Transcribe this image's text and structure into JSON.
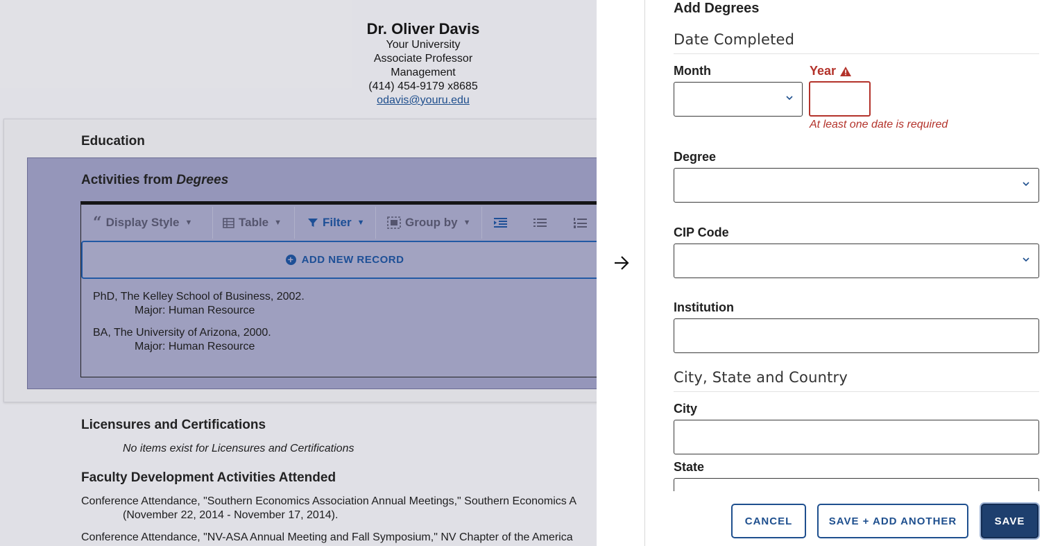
{
  "profile": {
    "name": "Dr. Oliver Davis",
    "university": "Your University",
    "rank": "Associate Professor",
    "department": "Management",
    "phone": "(414) 454-9179 x8685",
    "email": "odavis@youru.edu"
  },
  "education": {
    "heading": "Education",
    "activities_prefix": "Activities from ",
    "activities_emph": "Degrees",
    "toolbar": {
      "display_style": "Display Style",
      "table": "Table",
      "filter": "Filter",
      "group_by": "Group by"
    },
    "add_new_record": "ADD NEW RECORD",
    "records": [
      {
        "line": "PhD, The Kelley School of Business, 2002.",
        "major": "Major: Human Resource"
      },
      {
        "line": "BA, The University of Arizona, 2000.",
        "major": "Major: Human Resource"
      }
    ]
  },
  "licensures": {
    "heading": "Licensures and Certifications",
    "empty": "No items exist for Licensures and Certifications"
  },
  "faculty_dev": {
    "heading": "Faculty Development Activities Attended",
    "items": [
      {
        "line1": "Conference Attendance, \"Southern Economics Association Annual Meetings,\" Southern Economics A",
        "line2": "(November 22, 2014 - November 17, 2014)."
      },
      {
        "line1": "Conference Attendance, \"NV-ASA Annual Meeting and Fall Symposium,\" NV Chapter of the America"
      }
    ]
  },
  "form": {
    "title": "Add Degrees",
    "date_section": "Date Completed",
    "month_label": "Month",
    "month_value": "",
    "year_label": "Year",
    "year_value": "",
    "year_error": "At least one date is required",
    "degree_label": "Degree",
    "degree_value": "",
    "cip_label": "CIP Code",
    "cip_value": "",
    "institution_label": "Institution",
    "institution_value": "",
    "location_section": "City, State and Country",
    "city_label": "City",
    "city_value": "",
    "state_label": "State",
    "state_value": ""
  },
  "buttons": {
    "cancel": "CANCEL",
    "save_add_another": "SAVE + ADD ANOTHER",
    "save": "SAVE"
  },
  "colors": {
    "accent": "#1e4f8e",
    "error": "#b3322a",
    "primary_button": "#1e3f6e"
  }
}
